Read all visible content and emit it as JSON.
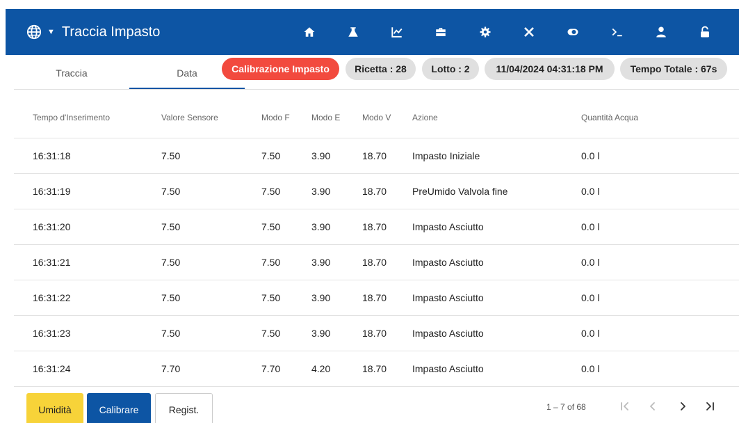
{
  "header": {
    "title": "Traccia Impasto",
    "background": "#0d55a4",
    "nav_icons": [
      "home-icon",
      "flask-icon",
      "chart-icon",
      "toolbox-icon",
      "gear-icon",
      "tools-icon",
      "toggle-icon",
      "terminal-icon",
      "user-icon",
      "unlock-icon"
    ]
  },
  "tabs": [
    {
      "label": "Traccia",
      "active": false
    },
    {
      "label": "Data",
      "active": true
    }
  ],
  "chips": {
    "calibration": "Calibrazione Impasto",
    "recipe": "Ricetta : 28",
    "batch": "Lotto : 2",
    "datetime": "11/04/2024 04:31:18 PM",
    "total_time": "Tempo Totale : 67s",
    "calibration_color": "#f24a3e"
  },
  "table": {
    "columns": [
      "Tempo d'Inserimento",
      "Valore Sensore",
      "Modo F",
      "Modo E",
      "Modo V",
      "Azione",
      "Quantità Acqua"
    ],
    "rows": [
      [
        "16:31:18",
        "7.50",
        "7.50",
        "3.90",
        "18.70",
        "Impasto Iniziale",
        "0.0 l"
      ],
      [
        "16:31:19",
        "7.50",
        "7.50",
        "3.90",
        "18.70",
        "PreUmido Valvola fine",
        "0.0 l"
      ],
      [
        "16:31:20",
        "7.50",
        "7.50",
        "3.90",
        "18.70",
        "Impasto Asciutto",
        "0.0 l"
      ],
      [
        "16:31:21",
        "7.50",
        "7.50",
        "3.90",
        "18.70",
        "Impasto Asciutto",
        "0.0 l"
      ],
      [
        "16:31:22",
        "7.50",
        "7.50",
        "3.90",
        "18.70",
        "Impasto Asciutto",
        "0.0 l"
      ],
      [
        "16:31:23",
        "7.50",
        "7.50",
        "3.90",
        "18.70",
        "Impasto Asciutto",
        "0.0 l"
      ],
      [
        "16:31:24",
        "7.70",
        "7.70",
        "4.20",
        "18.70",
        "Impasto Asciutto",
        "0.0 l"
      ]
    ]
  },
  "footer": {
    "humidity_button": "Umidità",
    "calibrate_button": "Calibrare",
    "register_button": "Regist.",
    "range": "1 – 7 of 68"
  }
}
